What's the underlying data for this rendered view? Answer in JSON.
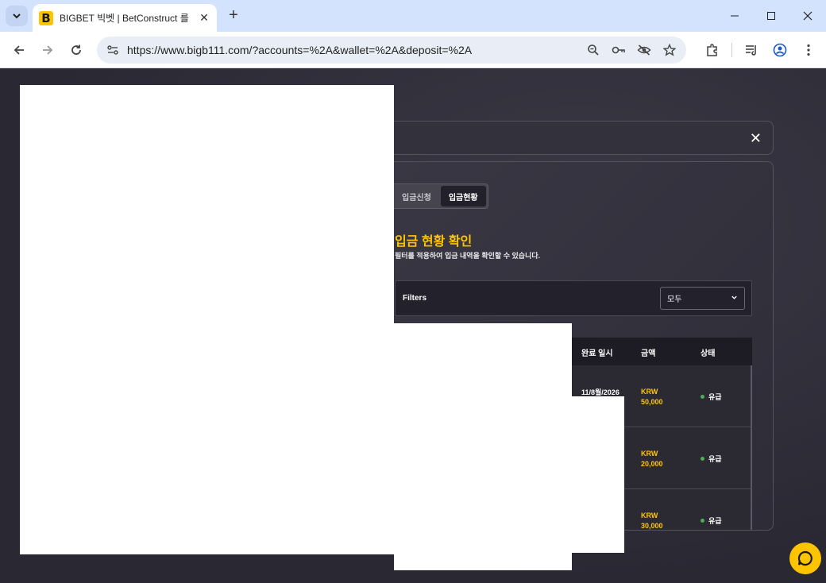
{
  "browser": {
    "tab_title": "BIGBET 빅벳 | BetConstruct 를",
    "favicon_letter": "B",
    "url": "https://www.bigb111.com/?accounts=%2A&wallet=%2A&deposit=%2A"
  },
  "panel": {
    "tabs": [
      {
        "label": "입금신청",
        "active": false
      },
      {
        "label": "입금현황",
        "active": true
      }
    ],
    "heading": "입금 현황 확인",
    "subtext": "필터를 적용하여 입금 내역을 확인할 수 있습니다.",
    "filters_label": "Filters",
    "filter_value": "모두",
    "columns": {
      "completed": "완료 일시",
      "amount": "금액",
      "status": "상태"
    },
    "rows": [
      {
        "date": "11/8월/2026",
        "currency": "KRW",
        "amount": "50,000",
        "status": "유급"
      },
      {
        "date": "",
        "currency": "KRW",
        "amount": "20,000",
        "status": "유급"
      },
      {
        "date": "",
        "currency": "KRW",
        "amount": "30,000",
        "status": "유급"
      }
    ]
  },
  "colors": {
    "accent": "#ffc400",
    "status_dot": "#4caf50",
    "background": "#2c2a35"
  }
}
